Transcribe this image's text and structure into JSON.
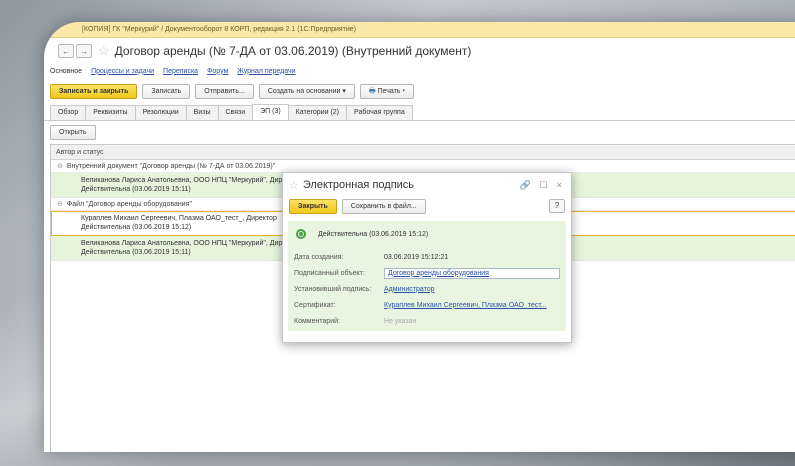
{
  "window": {
    "title": "[КОПИЯ] ГК \"Меркурий\" / Документооборот 8 КОРП, редакция 2.1   (1С:Предприятие)"
  },
  "document": {
    "title": "Договор аренды (№ 7-ДА от 03.06.2019) (Внутренний документ)",
    "sections": {
      "main": "Основное",
      "processes": "Процессы и задачи",
      "correspondence": "Переписка",
      "forum": "Форум",
      "journal": "Журнал передачи"
    }
  },
  "toolbar": {
    "save_close": "Записать и закрыть",
    "save": "Записать",
    "send": "Отправить...",
    "create_based": "Создать на основании ▾",
    "print": "Печать ▾"
  },
  "tabs": [
    "Обзор",
    "Реквизиты",
    "Резолюции",
    "Визы",
    "Связи",
    "ЭП (3)",
    "Категории (2)",
    "Рабочая группа"
  ],
  "signatures": {
    "open_button": "Открыть",
    "column_header": "Автор и статус",
    "group1": "Внутренний документ \"Договор аренды (№ 7-ДА от 03.06.2019)\"",
    "row1_author": "Великанова Лариса Анатольевна, ООО НПЦ \"Меркурий\", Директор",
    "row1_status": "Действительна (03.06.2019 15:11)",
    "group2": "Файл \"Договор аренды оборудования\"",
    "row2_author": "Кураплев Михаил Сергеевич, Плазма ОАО_тест_, Директор",
    "row2_status": "Действительна (03.06.2019 15:12)",
    "row3_author": "Великанова Лариса Анатольевна, ООО НПЦ \"Меркурий\", Директор",
    "row3_status": "Действительна (03.06.2019 15:11)"
  },
  "dialog": {
    "title": "Электронная подпись",
    "close_button": "Закрыть",
    "save_to_file": "Сохранить в файл...",
    "help": "?",
    "status": "Действительна (03.06.2019 15:12)",
    "fields": {
      "created_label": "Дата создания:",
      "created_value": "03.06.2019 15:12:21",
      "object_label": "Подписанный объект:",
      "object_value": "Договор аренды оборудования",
      "installer_label": "Установивший подпись:",
      "installer_value": "Администратор",
      "cert_label": "Сертификат:",
      "cert_value": "Кураплев Михаил Сергеевич, Плазма ОАО_тест...",
      "comment_label": "Комментарий:",
      "comment_value": "Не указан"
    }
  },
  "colors": {
    "accent": "#f1c81c",
    "valid": "#4aa043",
    "link": "#2850a8"
  }
}
